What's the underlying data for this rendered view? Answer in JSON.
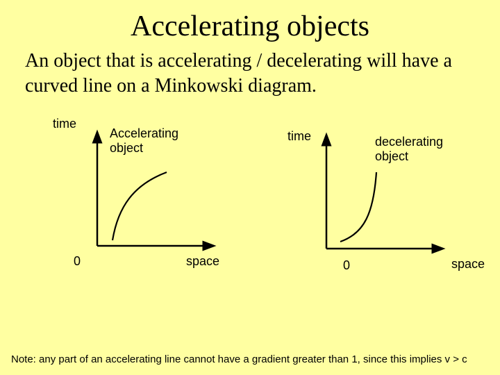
{
  "title": "Accelerating objects",
  "body": "An object that is accelerating / decelerating will have a curved line on a Minkowski diagram.",
  "left": {
    "y_label": "time",
    "x_label": "space",
    "zero": "0",
    "label": "Accelerating\nobject"
  },
  "right": {
    "y_label": "time",
    "x_label": "space",
    "zero": "0",
    "label": "decelerating\nobject"
  },
  "note": "Note: any part of an accelerating line cannot have a gradient greater than 1, since this implies v > c",
  "chart_data": [
    {
      "type": "line",
      "title": "Accelerating object",
      "xlabel": "space",
      "ylabel": "time",
      "series": [
        {
          "name": "worldline",
          "description": "concave-up curve starting near origin, steep initially then bending toward larger space (gradient decreasing toward 1)"
        }
      ]
    },
    {
      "type": "line",
      "title": "decelerating object",
      "xlabel": "space",
      "ylabel": "time",
      "series": [
        {
          "name": "worldline",
          "description": "concave-down curve starting shallow then steepening toward vertical (gradient increasing)"
        }
      ]
    }
  ]
}
